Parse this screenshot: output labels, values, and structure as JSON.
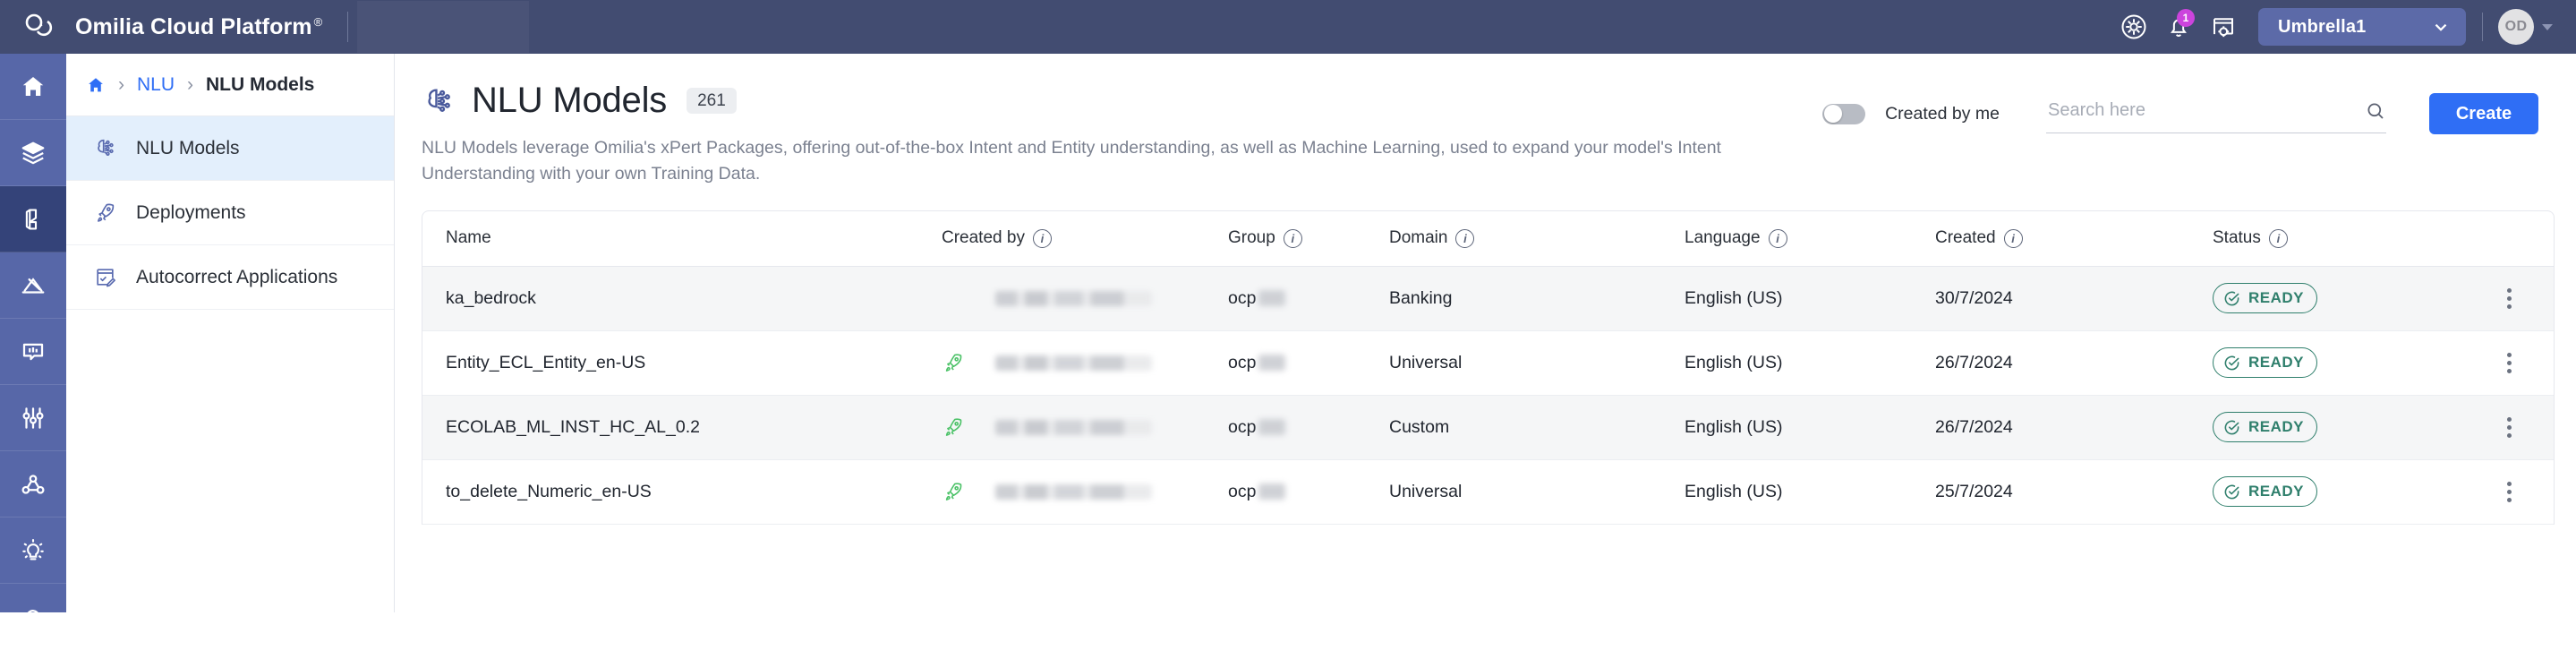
{
  "header": {
    "brand_name": "Omilia Cloud Platform",
    "brand_reg": "®",
    "logo_icon": "omilia-cloud-logo",
    "icons": [
      {
        "name": "support-gear-circle-icon"
      },
      {
        "name": "notifications-bell-icon",
        "badge": "1"
      },
      {
        "name": "app-settings-window-icon"
      }
    ],
    "tenant": {
      "label": "Umbrella1",
      "caret_icon": "chevron-down-icon"
    },
    "avatar": {
      "initials": "OD",
      "caret_icon": "caret-down-icon"
    }
  },
  "icon_rail": [
    {
      "name": "home-icon",
      "active": false
    },
    {
      "name": "layers-icon",
      "active": false
    },
    {
      "name": "nlu-model-icon",
      "active": true
    },
    {
      "name": "analytics-icon",
      "active": false
    },
    {
      "name": "dialog-icon",
      "active": false
    },
    {
      "name": "tuning-sliders-icon",
      "active": false
    },
    {
      "name": "graph-network-icon",
      "active": false
    },
    {
      "name": "insights-bulb-icon",
      "active": false
    },
    {
      "name": "cloud-icon",
      "active": false
    }
  ],
  "breadcrumb": {
    "home_icon": "home-icon",
    "separator": "›",
    "link": "NLU",
    "current": "NLU Models"
  },
  "sidebar": {
    "items": [
      {
        "label": "NLU Models",
        "icon": "brain-nlu-icon",
        "active": true
      },
      {
        "label": "Deployments",
        "icon": "rocket-icon",
        "active": false
      },
      {
        "label": "Autocorrect Applications",
        "icon": "autocorrect-doc-icon",
        "active": false
      }
    ]
  },
  "page": {
    "title": "NLU Models",
    "title_icon": "brain-nlu-icon",
    "count": "261",
    "description": "NLU Models leverage Omilia's xPert Packages, offering out-of-the-box Intent and Entity understanding, as well as Machine Learning, used to expand your model's Intent Understanding with your own Training Data."
  },
  "toolbar": {
    "toggle_label": "Created by me",
    "toggle_on": false,
    "search_placeholder": "Search here",
    "search_value": "",
    "search_icon": "search-icon",
    "create_label": "Create"
  },
  "table": {
    "columns": [
      {
        "label": "Name",
        "info": false
      },
      {
        "label": "Created by",
        "info": true
      },
      {
        "label": "Group",
        "info": true
      },
      {
        "label": "Domain",
        "info": true
      },
      {
        "label": "Language",
        "info": true
      },
      {
        "label": "Created",
        "info": true
      },
      {
        "label": "Status",
        "info": true
      }
    ],
    "rows": [
      {
        "name": "ka_bedrock",
        "deployed": false,
        "created_by": "",
        "group": "ocp",
        "domain": "Banking",
        "language": "English (US)",
        "created": "30/7/2024",
        "status": "READY"
      },
      {
        "name": "Entity_ECL_Entity_en-US",
        "deployed": true,
        "created_by": "",
        "group": "ocp",
        "domain": "Universal",
        "language": "English (US)",
        "created": "26/7/2024",
        "status": "READY"
      },
      {
        "name": "ECOLAB_ML_INST_HC_AL_0.2",
        "deployed": true,
        "created_by": "",
        "group": "ocp",
        "domain": "Custom",
        "language": "English (US)",
        "created": "26/7/2024",
        "status": "READY"
      },
      {
        "name": "to_delete_Numeric_en-US",
        "deployed": true,
        "created_by": "",
        "group": "ocp",
        "domain": "Universal",
        "language": "English (US)",
        "created": "25/7/2024",
        "status": "READY"
      }
    ],
    "row_menu_icon": "kebab-menu-icon",
    "status_icon": "check-circle-icon"
  },
  "colors": {
    "header_bg": "#424c71",
    "rail_bg": "#5767a8",
    "rail_active": "#344379",
    "accent_blue": "#2f6ef5",
    "nav_active_bg": "#e3effc",
    "badge_green": "#2f7f6c",
    "rocket_green": "#4cc268",
    "notification_pink": "#cc44dd"
  }
}
